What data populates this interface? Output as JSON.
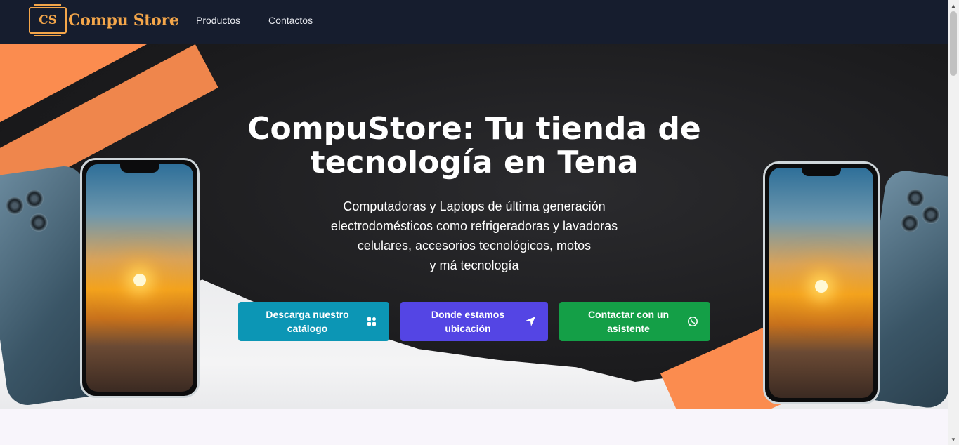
{
  "navbar": {
    "logo_text": "CS",
    "brand_name": "Compu Store",
    "links": [
      "Productos",
      "Contactos"
    ]
  },
  "hero": {
    "title": "CompuStore: Tu tienda de tecnología en Tena",
    "description_lines": [
      "Computadoras y Laptops de última generación",
      "electrodomésticos como refrigeradoras y lavadoras",
      "celulares, accesorios tecnológicos, motos",
      "y má tecnología"
    ],
    "buttons": {
      "catalog": {
        "label": "Descarga nuestro catálogo",
        "icon": "grid-icon",
        "color": "#0c96b5"
      },
      "location": {
        "label": "Donde estamos ubicación",
        "icon": "location-arrow-icon",
        "color": "#5445e4"
      },
      "whatsapp": {
        "label": "Contactar con un asistente",
        "icon": "whatsapp-icon",
        "color": "#149f47"
      }
    }
  },
  "colors": {
    "navbar_bg": "#161d2e",
    "brand_accent": "#f4a64a",
    "stripe_orange": "#fb8c4f"
  }
}
